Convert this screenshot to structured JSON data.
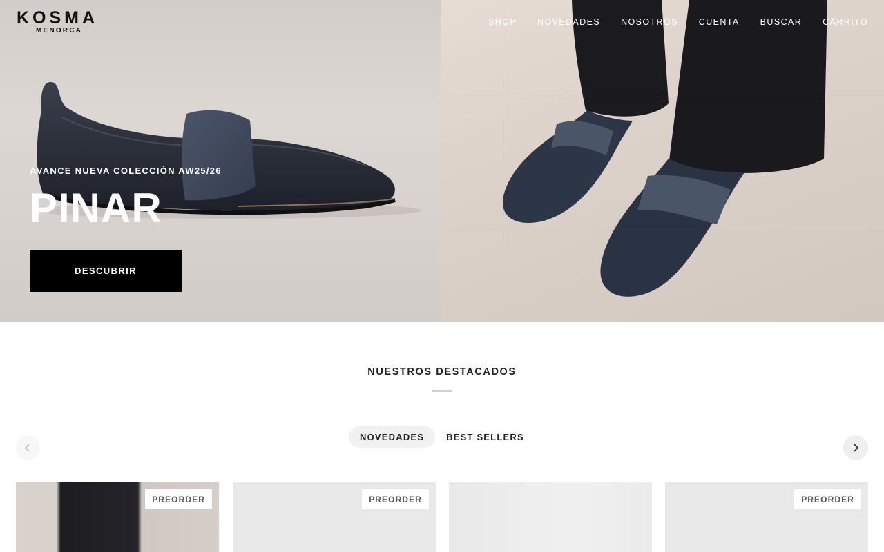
{
  "brand": {
    "name": "KOSMA",
    "tagline": "MENORCA"
  },
  "nav": {
    "items": [
      "SHOP",
      "NOVEDADES",
      "NOSOTROS",
      "CUENTA",
      "BUSCAR",
      "CARRITO"
    ]
  },
  "hero": {
    "eyebrow": "AVANCE NUEVA COLECCIÓN AW25/26",
    "title": "PINAR",
    "cta_label": "DESCUBRIR"
  },
  "featured": {
    "title": "NUESTROS DESTACADOS",
    "tabs": [
      {
        "label": "NOVEDADES",
        "active": true
      },
      {
        "label": "BEST SELLERS",
        "active": false
      }
    ],
    "prev_icon": "chevron-left-icon",
    "next_icon": "chevron-right-icon",
    "products": [
      {
        "badge": "PREORDER"
      },
      {
        "badge": "PREORDER"
      },
      {
        "badge": ""
      },
      {
        "badge": "PREORDER"
      }
    ]
  },
  "colors": {
    "accent": "#000000",
    "hero_text": "#ffffff",
    "tab_active_bg": "#f1f1f1"
  }
}
